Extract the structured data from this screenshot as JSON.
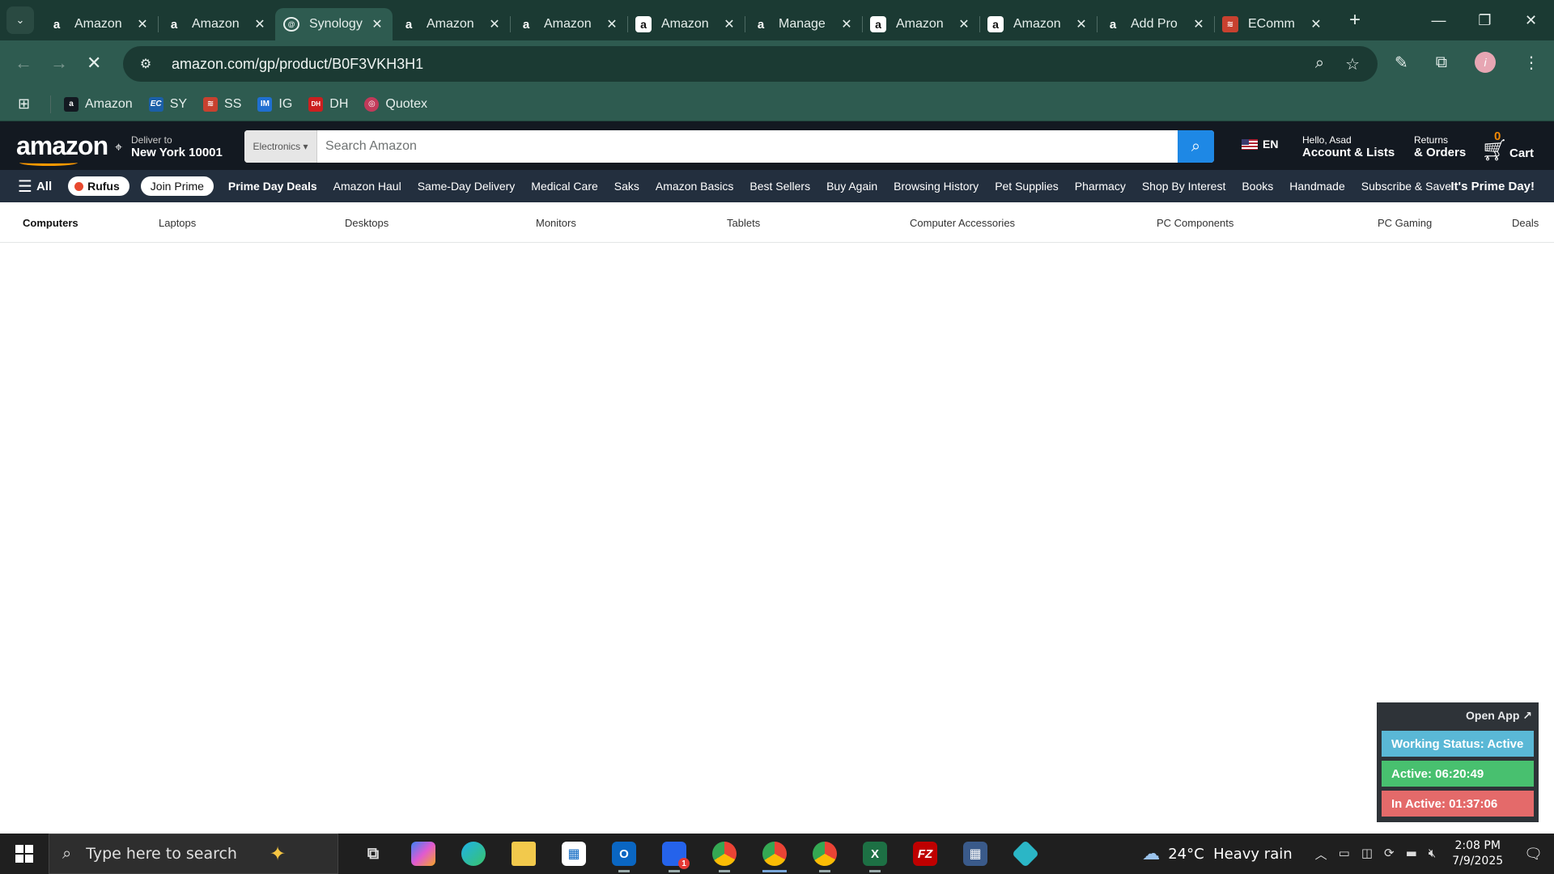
{
  "browser": {
    "tabs": [
      {
        "title": "Amazon",
        "icon": "amazon-a-icon"
      },
      {
        "title": "Amazon",
        "icon": "amazon-a-icon"
      },
      {
        "title": "Synology",
        "icon": "synology-icon",
        "active": true
      },
      {
        "title": "Amazon",
        "icon": "amazon-a-icon"
      },
      {
        "title": "Amazon",
        "icon": "amazon-a-icon"
      },
      {
        "title": "Amazon",
        "icon": "amazon-box-icon"
      },
      {
        "title": "Manage",
        "icon": "amazon-a-icon"
      },
      {
        "title": "Amazon",
        "icon": "amazon-box-icon"
      },
      {
        "title": "Amazon",
        "icon": "amazon-box-icon"
      },
      {
        "title": "Add Pro",
        "icon": "amazon-a-icon"
      },
      {
        "title": "EComm",
        "icon": "ecomm-icon"
      }
    ],
    "url": "amazon.com/gp/product/B0F3VKH3H1",
    "bookmarks": [
      {
        "label": "Amazon",
        "color": "#131921",
        "glyph": "a"
      },
      {
        "label": "SY",
        "color": "#1b5fa8",
        "glyph": "EC"
      },
      {
        "label": "SS",
        "color": "#c8412f",
        "glyph": "S"
      },
      {
        "label": "IG",
        "color": "#1f6fd1",
        "glyph": "IM"
      },
      {
        "label": "DH",
        "color": "#cc1f1f",
        "glyph": "DH"
      },
      {
        "label": "Quotex",
        "color": "#c23a5a",
        "glyph": "Q"
      }
    ]
  },
  "amazon": {
    "logo": "amazon",
    "deliver_line1": "Deliver to",
    "deliver_line2": "New York 10001",
    "search_category": "Electronics",
    "search_placeholder": "Search Amazon",
    "language": "EN",
    "account_line1": "Hello, Asad",
    "account_line2": "Account & Lists",
    "orders_line1": "Returns",
    "orders_line2": "& Orders",
    "cart_count": "0",
    "cart_label": "Cart",
    "nav_all": "All",
    "rufus": "Rufus",
    "join_prime": "Join Prime",
    "nav_links": [
      "Prime Day Deals",
      "Amazon Haul",
      "Same-Day Delivery",
      "Medical Care",
      "Saks",
      "Amazon Basics",
      "Best Sellers",
      "Buy Again",
      "Browsing History",
      "Pet Supplies",
      "Pharmacy",
      "Shop By Interest",
      "Books",
      "Handmade",
      "Subscribe & Save"
    ],
    "nav_promo": "It's Prime Day!",
    "subnav": [
      "Computers",
      "Laptops",
      "Desktops",
      "Monitors",
      "Tablets",
      "Computer Accessories",
      "PC Components",
      "PC Gaming",
      "Deals"
    ]
  },
  "widget": {
    "open_app": "Open App ↗",
    "working_status": "Working Status: Active",
    "active": "Active: 06:20:49",
    "inactive": "In Active: 01:37:06",
    "colors": {
      "status": "#5ab8d6",
      "active": "#48c06f",
      "inactive": "#e46a6a"
    }
  },
  "taskbar": {
    "search_placeholder": "Type here to search",
    "weather_temp": "24°C",
    "weather_desc": "Heavy rain",
    "time": "2:08 PM",
    "date": "7/9/2025",
    "notification_count": "1"
  }
}
